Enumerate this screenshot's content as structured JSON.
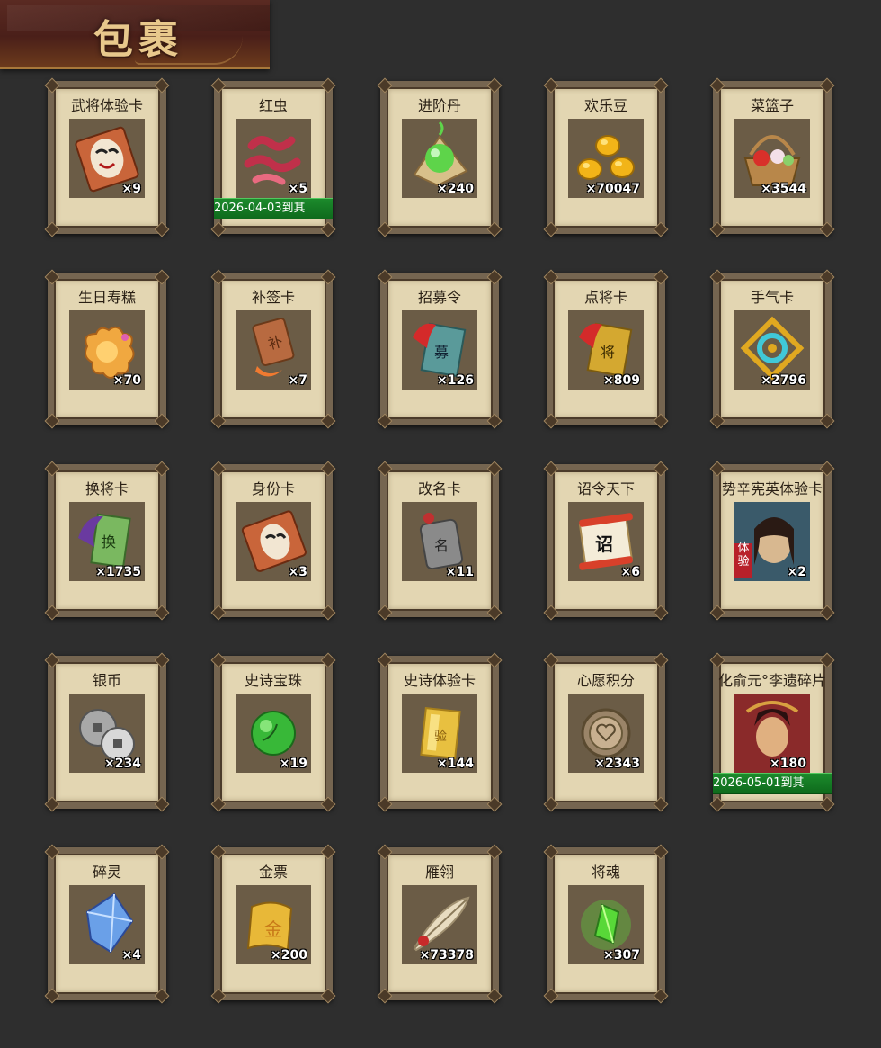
{
  "header": {
    "title": "包裹"
  },
  "items": [
    {
      "name": "武将体验卡",
      "qty": "×9",
      "icon": "opera-mask-card-icon",
      "colors": {
        "main": "#c9653a",
        "accent": "#f2e6d2"
      }
    },
    {
      "name": "红虫",
      "qty": "×5",
      "icon": "red-worm-icon",
      "colors": {
        "main": "#c0304a",
        "accent": "#e86a80"
      },
      "expiry": "2026-04-03到其"
    },
    {
      "name": "进阶丹",
      "qty": "×240",
      "icon": "advance-pill-icon",
      "colors": {
        "main": "#5ed44a",
        "accent": "#d8c08a"
      }
    },
    {
      "name": "欢乐豆",
      "qty": "×70047",
      "icon": "gold-beans-icon",
      "colors": {
        "main": "#f2b418",
        "accent": "#ffe27a"
      }
    },
    {
      "name": "菜篮子",
      "qty": "×3544",
      "icon": "vegetable-basket-icon",
      "colors": {
        "main": "#b8874a",
        "accent": "#d8302a"
      }
    },
    {
      "name": "生日寿糕",
      "qty": "×70",
      "icon": "birthday-cake-icon",
      "colors": {
        "main": "#f0a840",
        "accent": "#ffd070"
      }
    },
    {
      "name": "补签卡",
      "qty": "×7",
      "icon": "resign-card-icon",
      "colors": {
        "main": "#b86a40",
        "accent": "#f07a30"
      }
    },
    {
      "name": "招募令",
      "qty": "×126",
      "icon": "recruit-token-icon",
      "colors": {
        "main": "#5a9a9a",
        "accent": "#d42a2a"
      }
    },
    {
      "name": "点将卡",
      "qty": "×809",
      "icon": "general-select-card-icon",
      "colors": {
        "main": "#d4a830",
        "accent": "#d42a2a"
      }
    },
    {
      "name": "手气卡",
      "qty": "×2796",
      "icon": "luck-card-icon",
      "colors": {
        "main": "#e0a820",
        "accent": "#40c8d8"
      }
    },
    {
      "name": "换将卡",
      "qty": "×1735",
      "icon": "swap-general-card-icon",
      "colors": {
        "main": "#7ab860",
        "accent": "#6a3aa0"
      }
    },
    {
      "name": "身份卡",
      "qty": "×3",
      "icon": "identity-card-icon",
      "colors": {
        "main": "#c9653a",
        "accent": "#f2e6d2"
      }
    },
    {
      "name": "改名卡",
      "qty": "×11",
      "icon": "rename-card-icon",
      "colors": {
        "main": "#8a8a8a",
        "accent": "#c03030"
      }
    },
    {
      "name": "诏令天下",
      "qty": "×6",
      "icon": "imperial-edict-icon",
      "colors": {
        "main": "#d8402a",
        "accent": "#f4ecd8"
      }
    },
    {
      "name": "势辛宪英体验卡",
      "qty": "×2",
      "icon": "hero-portrait-female-icon",
      "colors": {
        "main": "#d8b890",
        "accent": "#b8202a"
      },
      "badge": "体验"
    },
    {
      "name": "银币",
      "qty": "×234",
      "icon": "silver-coins-icon",
      "colors": {
        "main": "#a8a8a8",
        "accent": "#d8d8d8"
      }
    },
    {
      "name": "史诗宝珠",
      "qty": "×19",
      "icon": "epic-orb-icon",
      "colors": {
        "main": "#38b838",
        "accent": "#9af08a"
      }
    },
    {
      "name": "史诗体验卡",
      "qty": "×144",
      "icon": "epic-trial-card-icon",
      "colors": {
        "main": "#e8c040",
        "accent": "#fff0a0"
      }
    },
    {
      "name": "心愿积分",
      "qty": "×2343",
      "icon": "wish-points-coin-icon",
      "colors": {
        "main": "#9a8468",
        "accent": "#c8b090"
      }
    },
    {
      "name": "化俞元°李遗碎片",
      "qty": "×180",
      "icon": "hero-portrait-male-icon",
      "colors": {
        "main": "#8a2a2a",
        "accent": "#e0b080"
      },
      "expiry": "2026-05-01到其"
    },
    {
      "name": "碎灵",
      "qty": "×4",
      "icon": "spirit-shard-icon",
      "colors": {
        "main": "#6aa0e8",
        "accent": "#c8e0ff"
      }
    },
    {
      "name": "金票",
      "qty": "×200",
      "icon": "gold-ticket-icon",
      "colors": {
        "main": "#e8b838",
        "accent": "#c87818"
      }
    },
    {
      "name": "雁翎",
      "qty": "×73378",
      "icon": "goose-feather-icon",
      "colors": {
        "main": "#e8dcc0",
        "accent": "#c82a2a"
      }
    },
    {
      "name": "将魂",
      "qty": "×307",
      "icon": "general-soul-crystal-icon",
      "colors": {
        "main": "#58d838",
        "accent": "#c0ff90"
      }
    }
  ]
}
